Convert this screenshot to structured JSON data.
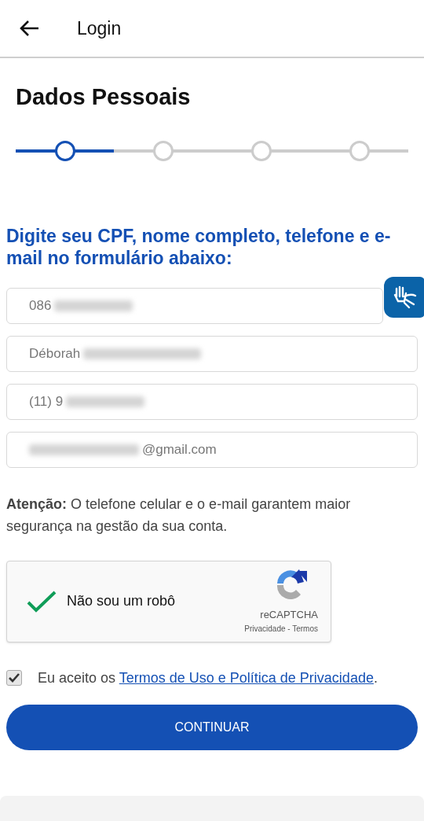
{
  "header": {
    "title": "Login"
  },
  "page_title": "Dados Pessoais",
  "stepper": {
    "level": 0.25,
    "steps": [
      {
        "selected": true
      },
      {
        "selected": false
      },
      {
        "selected": false
      },
      {
        "selected": false
      }
    ]
  },
  "instruction": "Digite seu CPF, nome completo, telefone e e-mail no formulário abaixo:",
  "fields": [
    {
      "value": "086",
      "redacted_after": true
    },
    {
      "value": "Déborah",
      "redacted_after": true
    },
    {
      "value": "(11) 9",
      "redacted_after": true
    },
    {
      "value": "@gmail.com",
      "redacted_before": true
    }
  ],
  "notice": "**Atenção:** O telefone celular e o e-mail garantem maior segurança na gestão da sua conta.",
  "captcha": {
    "checked": true,
    "label": "Não sou um robô",
    "brand": "reCAPTCHA",
    "links": "Privacidade - Termos"
  },
  "terms": {
    "checked": true,
    "text": "Eu aceito os",
    "link": "Termos de Uso e Política de Privacidade",
    "suffix": "."
  },
  "continue_button": "CONTINUAR"
}
